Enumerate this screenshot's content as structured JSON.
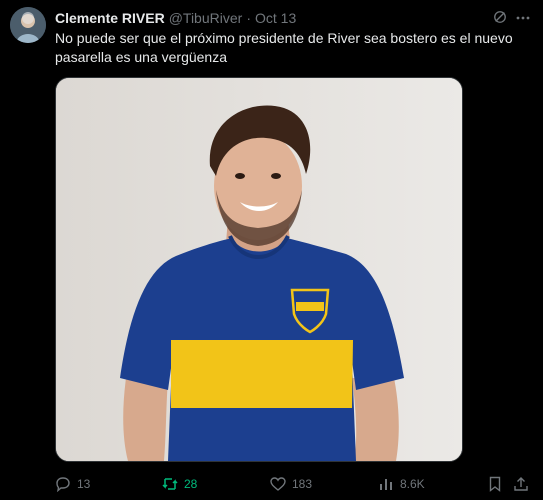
{
  "tweet": {
    "author_name": "Clemente RIVER",
    "handle": "@TibuRiver",
    "separator": "·",
    "date": "Oct 13",
    "text": "No puede ser que el próximo presidente de River sea bostero es el nuevo pasarella es una vergüenza"
  },
  "actions": {
    "replies": "13",
    "reposts": "28",
    "likes": "183",
    "views": "8.6K"
  },
  "colors": {
    "background": "#000000",
    "text": "#e7e9ea",
    "muted": "#71767b",
    "repost_active": "#00ba7c"
  }
}
